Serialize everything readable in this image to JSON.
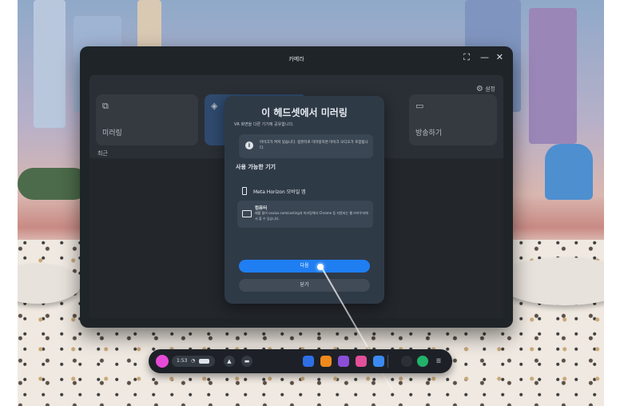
{
  "window": {
    "title": "카메라",
    "controls": {
      "snap": "⛶",
      "minimize": "—",
      "close": "✕"
    }
  },
  "app": {
    "settings_label": "설정",
    "cards": [
      {
        "label": "미러링",
        "icon": "cast-icon"
      },
      {
        "label": "",
        "icon": "camera-icon"
      },
      {
        "label": "방송하기",
        "icon": "broadcast-icon"
      }
    ],
    "recent_label": "최근"
  },
  "dialog": {
    "title": "이 헤드셋에서 미러링",
    "subtitle": "VR 화면을 다른 기기에 공유합니다.",
    "info_text": "마이크가 켜져 있습니다. 컴퓨터로 미러링하면 마이크 오디오가 포함됩니다.",
    "available_heading": "사용 가능한 기기",
    "devices": [
      {
        "name": "Meta Horizon 모바일 앱",
        "description": ""
      },
      {
        "name": "컴퓨터",
        "description": "예를 들어 oculus.com/casting과 미러링해서 Chrome 등 지원되는 웹 브라우저에서 볼 수 있습니다."
      }
    ],
    "next_label": "다음",
    "close_label": "닫기"
  },
  "taskbar": {
    "time": "1:53",
    "colors": {
      "accent": "#1f7ef2",
      "apps": [
        "#2f6fe6",
        "#f08a1c",
        "#8a4ed8",
        "#e34f9a",
        "#3b8af0",
        "#2c2f33",
        "#22b36a"
      ]
    }
  }
}
